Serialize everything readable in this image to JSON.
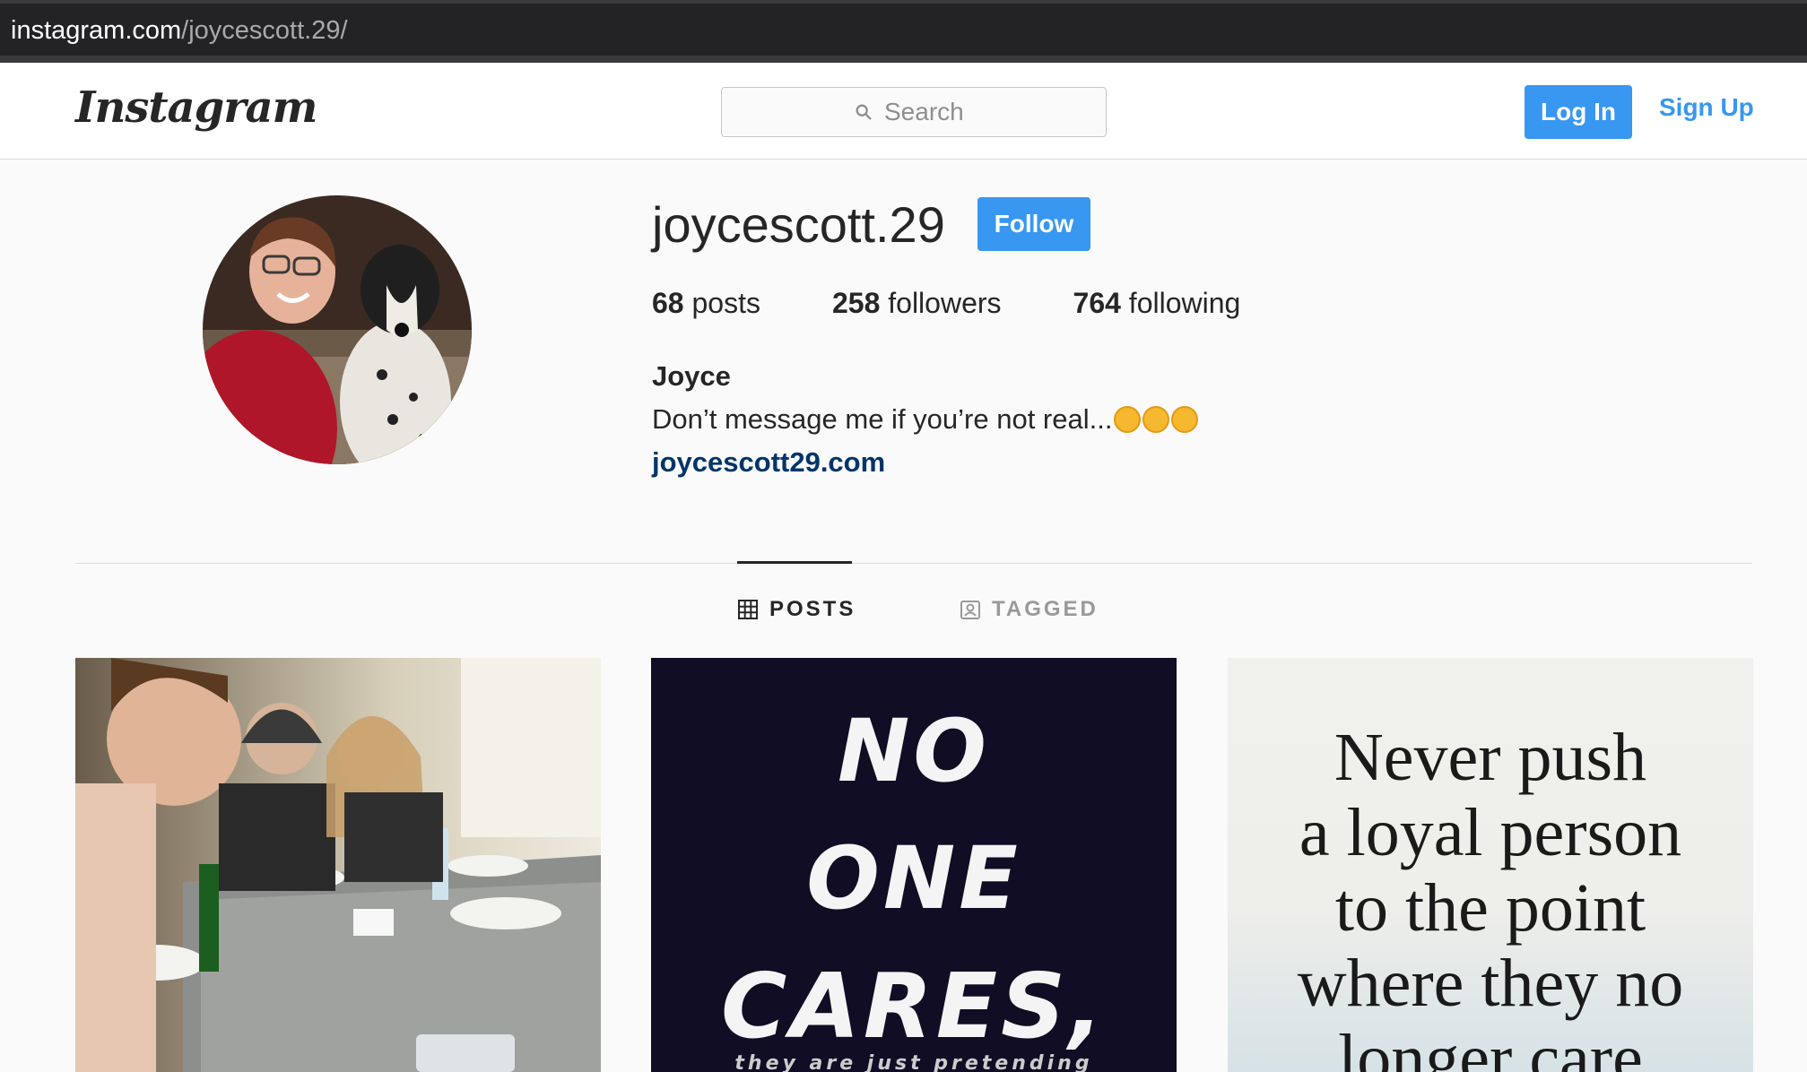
{
  "browser": {
    "url_host": "instagram.com",
    "url_path": "/joycescott.29/"
  },
  "header": {
    "logo": "Instagram",
    "search_placeholder": "Search",
    "login_label": "Log In",
    "signup_label": "Sign Up"
  },
  "profile": {
    "username": "joycescott.29",
    "follow_label": "Follow",
    "stats": {
      "posts_count": "68",
      "posts_label": "posts",
      "followers_count": "258",
      "followers_label": "followers",
      "following_count": "764",
      "following_label": "following"
    },
    "full_name": "Joyce",
    "bio": "Don’t message me if you’re not real...",
    "website": "joycescott29.com"
  },
  "tabs": {
    "posts_label": "POSTS",
    "tagged_label": "TAGGED"
  },
  "posts": {
    "post2_lines": [
      "NO",
      "ONE",
      "CARES,",
      "they are just pretending"
    ],
    "post3_lines": [
      "Never push",
      "a loyal person",
      "to the point",
      "where they no",
      "longer care"
    ]
  },
  "colors": {
    "accent": "#3897f0",
    "link": "#003569"
  }
}
